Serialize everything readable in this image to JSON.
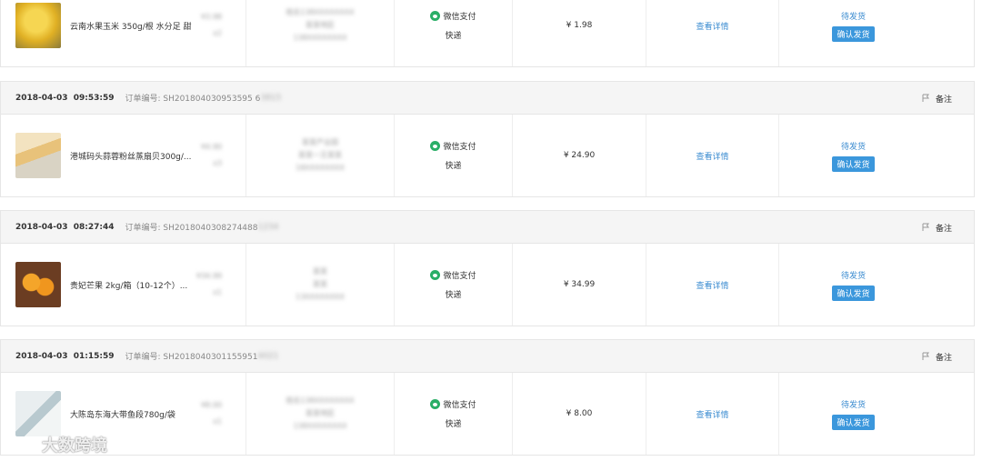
{
  "orders": [
    {
      "header": null,
      "product": {
        "image_icon": "corn-thumbnail",
        "name": "云南水果玉米 350g/根 水分足 甜",
        "price": "¥3.98",
        "qty": "x2"
      },
      "buyer": {
        "line1": "姓名138XXXXXXXX",
        "line2": "某某地区",
        "line3": "138XXXXXXXX"
      },
      "payment": {
        "method": "微信支付",
        "icon": "wechat-pay-icon",
        "shipping": "快递"
      },
      "total": "¥ 1.98",
      "detail_link": "查看详情",
      "status": "待发货",
      "confirm_button": "确认发货"
    },
    {
      "header": {
        "time": "2018-04-03 09:53:59",
        "order_label": "订单编号: SH201804030953595 6",
        "order_blur": "3815",
        "note": "备注"
      },
      "product": {
        "image_icon": "fans-scallop-thumbnail",
        "name": "港城码头蒜蓉粉丝蒸扇贝300g/...",
        "price": "¥4.90",
        "qty": "x3"
      },
      "buyer": {
        "line1": "某某产业园",
        "line2": "某某一王某某",
        "line3": "18XXXXXXXX"
      },
      "payment": {
        "method": "微信支付",
        "icon": "wechat-pay-icon",
        "shipping": "快递"
      },
      "total": "¥ 24.90",
      "detail_link": "查看详情",
      "status": "待发货",
      "confirm_button": "确认发货"
    },
    {
      "header": {
        "time": "2018-04-03 08:27:44",
        "order_label": "订单编号: SH2018040308274488",
        "order_blur": "1234",
        "note": "备注"
      },
      "product": {
        "image_icon": "mango-thumbnail",
        "name": "贵妃芒果 2kg/箱（10-12个）...",
        "price": "¥34.99",
        "qty": "x1"
      },
      "buyer": {
        "line1": "某某",
        "line2": "某某",
        "line3": "13XXXXXXXX"
      },
      "payment": {
        "method": "微信支付",
        "icon": "wechat-pay-icon",
        "shipping": "快递"
      },
      "total": "¥ 34.99",
      "detail_link": "查看详情",
      "status": "待发货",
      "confirm_button": "确认发货"
    },
    {
      "header": {
        "time": "2018-04-03 01:15:59",
        "order_label": "订单编号: SH2018040301155951",
        "order_blur": "4021",
        "note": "备注"
      },
      "product": {
        "image_icon": "fish-thumbnail",
        "name": "大陈岛东海大带鱼段780g/袋",
        "price": "¥8.00",
        "qty": "x1"
      },
      "buyer": {
        "line1": "姓名138XXXXXXXX",
        "line2": "某某地区",
        "line3": "138XXXXXXXX"
      },
      "payment": {
        "method": "微信支付",
        "icon": "wechat-pay-icon",
        "shipping": "快递"
      },
      "total": "¥ 8.00",
      "detail_link": "查看详情",
      "status": "待发货",
      "confirm_button": "确认发货"
    }
  ],
  "watermark": {
    "text": "大数跨境",
    "icon": "brand-logo-icon"
  },
  "colors": {
    "link": "#3a8bd0",
    "button": "#3b97dc",
    "wechat": "#2aae67",
    "header_bg": "#f5f5f5"
  }
}
